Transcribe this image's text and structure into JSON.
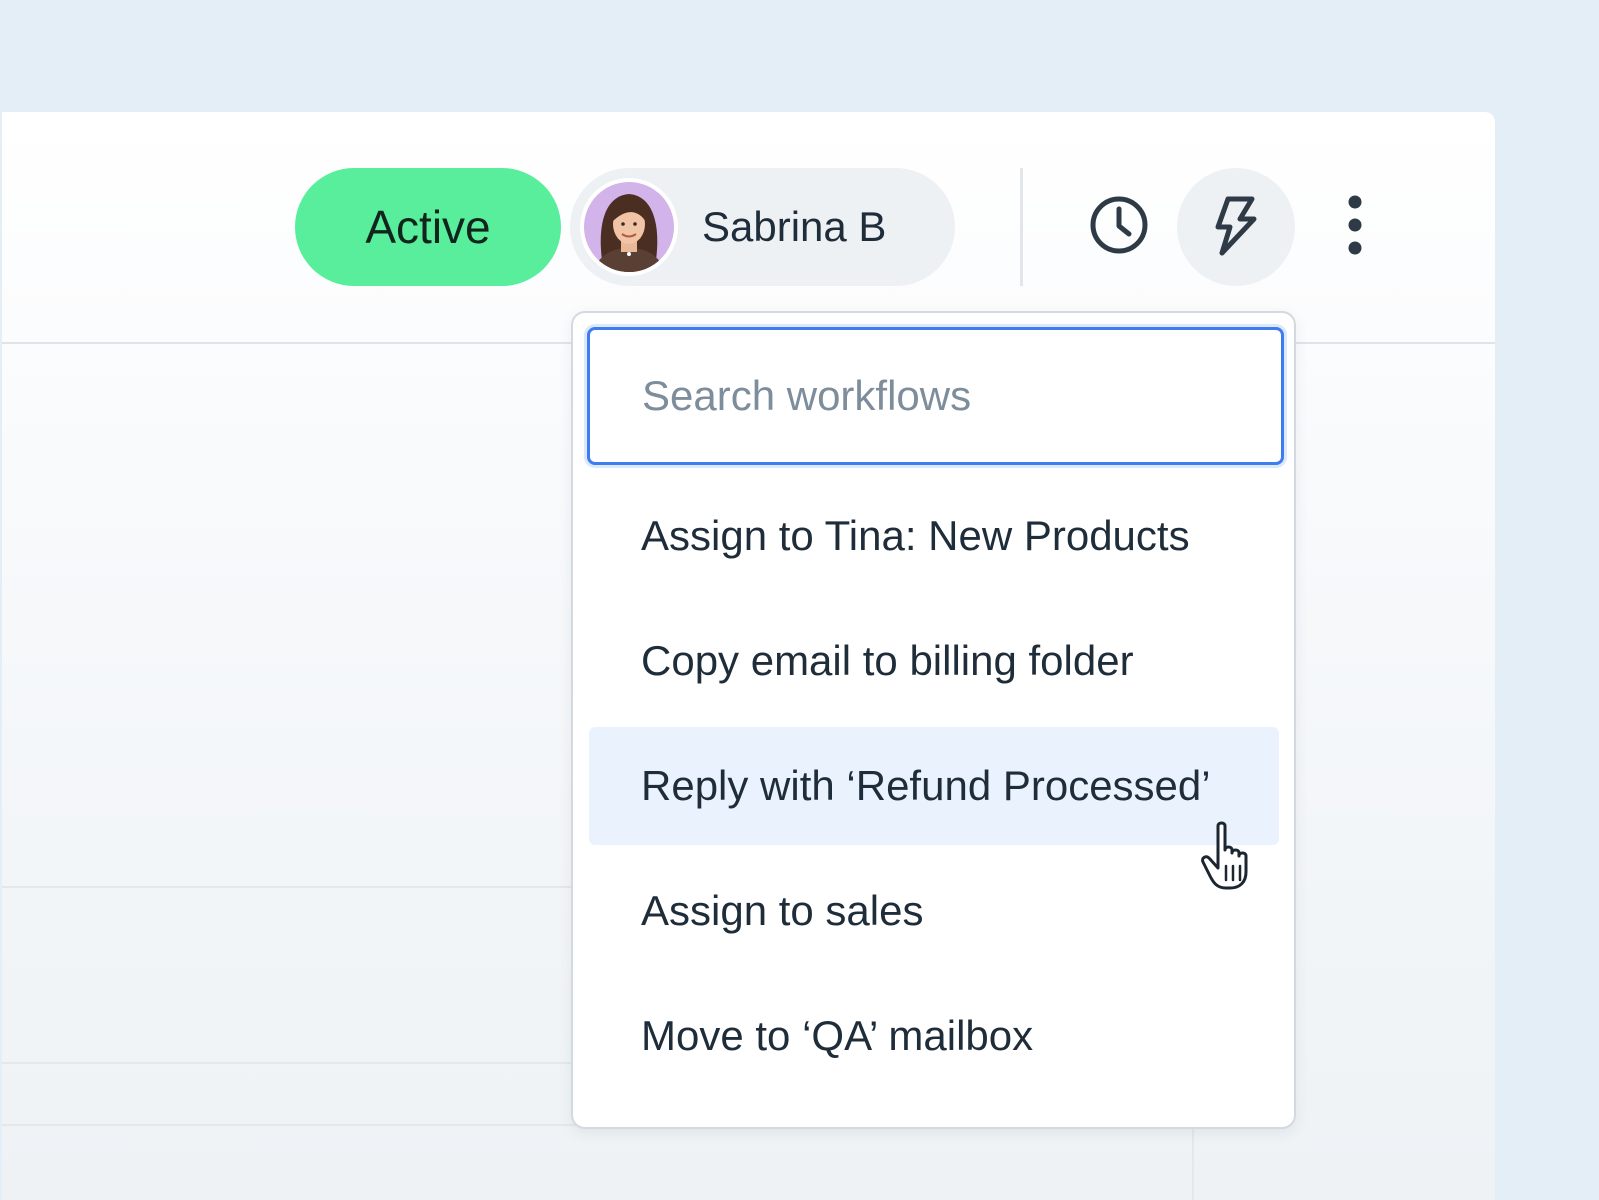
{
  "header": {
    "status_label": "Active",
    "status_color": "#58ee9c",
    "user": {
      "name": "Sabrina B",
      "avatar_icon": "user-photo"
    },
    "icons": {
      "history": "clock-icon",
      "workflows": "lightning-icon",
      "more": "vertical-ellipsis-icon"
    }
  },
  "dropdown": {
    "search": {
      "placeholder": "Search workflows",
      "value": ""
    },
    "items": [
      {
        "label": "Assign to Tina: New Products"
      },
      {
        "label": "Copy email to billing folder"
      },
      {
        "label": "Reply with ‘Refund Processed’",
        "state": "hovered"
      },
      {
        "label": "Assign to sales"
      },
      {
        "label": "Move to ‘QA’ mailbox"
      }
    ],
    "highlight_color": "#eaf3fd",
    "focus_color": "#3f7cef"
  }
}
